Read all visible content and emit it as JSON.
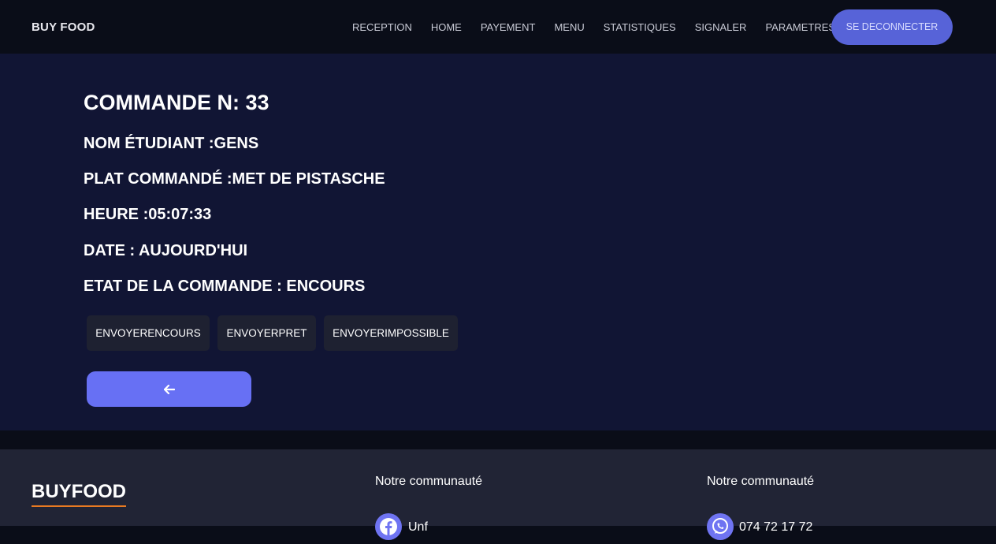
{
  "navbar": {
    "brand": "BUY FOOD",
    "links": [
      "RECEPTION",
      "HOME",
      "PAYEMENT",
      "MENU",
      "STATISTIQUES",
      "SIGNALER",
      "PARAMETRES"
    ],
    "logout_label": "SE DECONNECTER"
  },
  "order": {
    "title": "COMMANDE N: 33",
    "student": "NOM ÉTUDIANT :GENS",
    "dish": "PLAT COMMANDÉ :MET DE PISTASCHE",
    "time": "HEURE :05:07:33",
    "date": "DATE : AUJOURD'HUI",
    "status": "ETAT DE LA COMMANDE : ENCOURS"
  },
  "actions": {
    "encours": "ENVOYERENCOURS",
    "pret": "ENVOYERPRET",
    "impossible": "ENVOYERIMPOSSIBLE",
    "back_icon": "arrow-left-icon"
  },
  "footer": {
    "brand": "BUYFOOD",
    "col1_heading": "Notre communauté",
    "col1_link": "Unf",
    "col1_icon": "facebook-icon",
    "col2_heading": "Notre communauté",
    "col2_link": "074 72 17 72",
    "col2_icon": "whatsapp-icon"
  },
  "colors": {
    "nav_bg": "#0a0d18",
    "main_bg": "#111534",
    "logout_accent": "#5763d8",
    "back_button": "#6770f4",
    "footer_bg": "#212435",
    "underline": "#e87a22"
  }
}
